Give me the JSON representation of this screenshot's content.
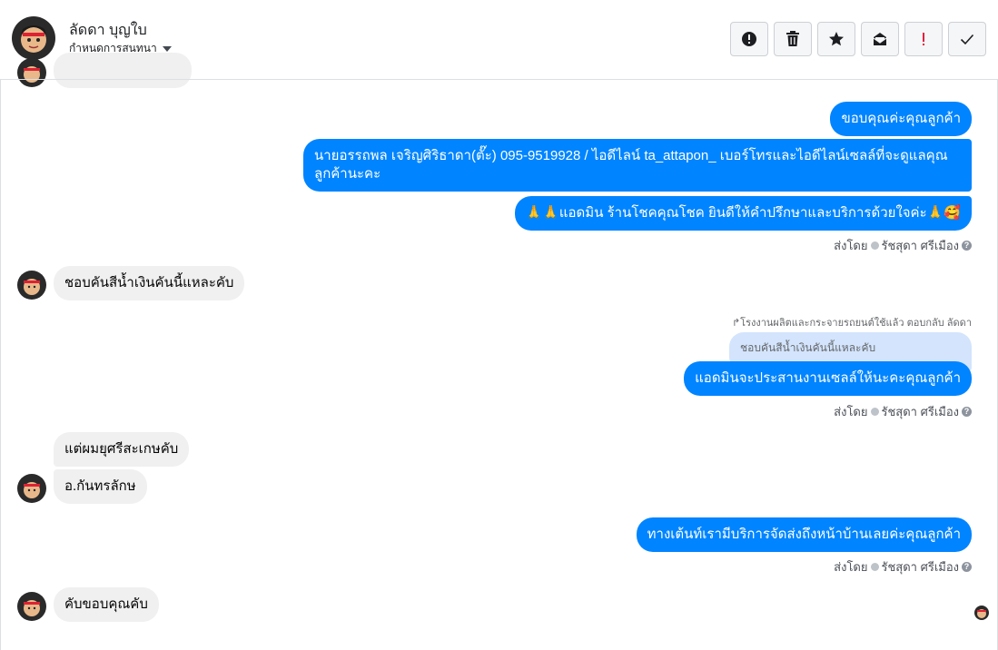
{
  "header": {
    "contact_name": "ลัดดา บุญใบ",
    "subtitle": "กำหนดการสนทนา",
    "avatar_icon": "user-photo"
  },
  "toolbar": {
    "buttons": [
      {
        "name": "alert-circle-icon",
        "tooltip": ""
      },
      {
        "name": "trash-icon",
        "tooltip": ""
      },
      {
        "name": "star-icon",
        "tooltip": ""
      },
      {
        "name": "mail-open-icon",
        "tooltip": ""
      },
      {
        "name": "exclamation-icon",
        "tooltip": ""
      },
      {
        "name": "check-icon",
        "tooltip": ""
      }
    ],
    "accent_red": "#e41e3f"
  },
  "messages": {
    "out1": "ขอบคุณค่ะคุณลูกค้า",
    "out2": "นายอรรถพล เจริญศิริธาดา(ตั๊ะ)      095-9519928 / ไอดีไลน์ ta_attapon_ เบอร์โทรและไอดีไลน์เซลล์ที่จะดูแลคุณลูกค้านะคะ",
    "out3": "🙏🙏แอดมิน ร้านโชคคุณโชค ยินดีให้คำปรึกษาและบริการด้วยใจค่ะ🙏🥰",
    "sent1_prefix": "ส่งโดย",
    "sent1_name": "รัชสุดา ศรีเมือง",
    "in1": "ชอบคันสีน้ำเงินคันนี้แหละคับ",
    "reply_note": "โรงงานผลิตและกระจายรถยนต์ใช้แล้ว ตอบกลับ ลัดดา",
    "quoted": "ชอบคันสีน้ำเงินคันนี้แหละคับ",
    "out4": "แอดมินจะประสานงานเซลล์ให้นะคะคุณลูกค้า",
    "sent2_prefix": "ส่งโดย",
    "sent2_name": "รัชสุดา ศรีเมือง",
    "in2": "แต่ผมยุศรีสะเกษคับ",
    "in3": "อ.กันทรลักษ",
    "out5": "ทางเต้นท์เรามีบริการจัดส่งถึงหน้าบ้านเลยค่ะคุณลูกค้า",
    "sent3_prefix": "ส่งโดย",
    "sent3_name": "รัชสุดา ศรีเมือง",
    "in4": "คับขอบคุณคับ"
  },
  "colors": {
    "outgoing_bubble": "#0084ff",
    "incoming_bubble": "#f0f0f0",
    "quote_bubble": "#d3e4fc"
  }
}
